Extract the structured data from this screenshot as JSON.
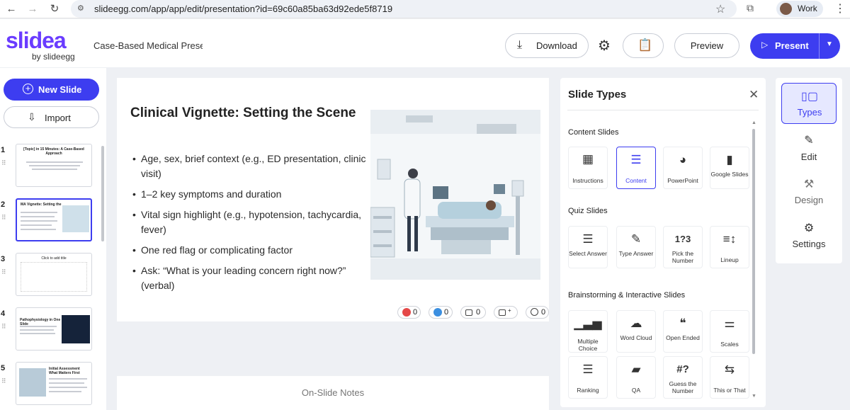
{
  "browser": {
    "url": "slideegg.com/app/app/edit/presentation?id=69c60a85ba63d92ede5f8719",
    "profile_label": "Work"
  },
  "header": {
    "logo_main": "slidea",
    "logo_sub": "by slideegg",
    "doc_title": "Case-Based Medical Prese",
    "download_label": "Download",
    "preview_label": "Preview",
    "present_label": "Present"
  },
  "sidebar": {
    "new_slide_label": "New Slide",
    "import_label": "Import",
    "thumbnails": [
      {
        "num": "1",
        "title": "[Topic] in 15 Minutes: A Case-Based Approach"
      },
      {
        "num": "2",
        "title": "MA  Vignette: Setting the"
      },
      {
        "num": "3",
        "title": "Click to add title"
      },
      {
        "num": "4",
        "title": "Pathophysiology in One Slide"
      },
      {
        "num": "5",
        "title": "Initial Assessment What Matters First"
      }
    ]
  },
  "slide": {
    "title": "Clinical Vignette: Setting the Scene",
    "bullets": [
      "Age, sex, brief context (e.g., ED presentation, clinic visit)",
      "1–2 key symptoms and duration",
      "Vital sign highlight (e.g., hypotension, tachycardia, fever)",
      "One red flag or complicating factor",
      "Ask: “What is your leading concern right now?” (verbal)"
    ],
    "reactions": [
      "0",
      "0",
      "0",
      "",
      "0"
    ]
  },
  "notes": {
    "label": "On-Slide Notes"
  },
  "panel": {
    "title": "Slide Types",
    "sections": [
      {
        "label": "Content Slides",
        "tiles": [
          "Instructions",
          "Content",
          "PowerPoint",
          "Google Slides"
        ]
      },
      {
        "label": "Quiz Slides",
        "tiles": [
          "Select Answer",
          "Type Answer",
          "Pick the Number",
          "Lineup"
        ]
      },
      {
        "label": "Brainstorming & Interactive Slides",
        "tiles": [
          "Multiple Choice",
          "Word Cloud",
          "Open Ended",
          "Scales",
          "Ranking",
          "QA",
          "Guess the Number",
          "This or That"
        ]
      }
    ]
  },
  "rail": {
    "items": [
      "Types",
      "Edit",
      "Design",
      "Settings"
    ]
  },
  "colors": {
    "accent": "#3d3df0",
    "logo": "#6a3cff",
    "logo_dot": "#e8374f"
  }
}
